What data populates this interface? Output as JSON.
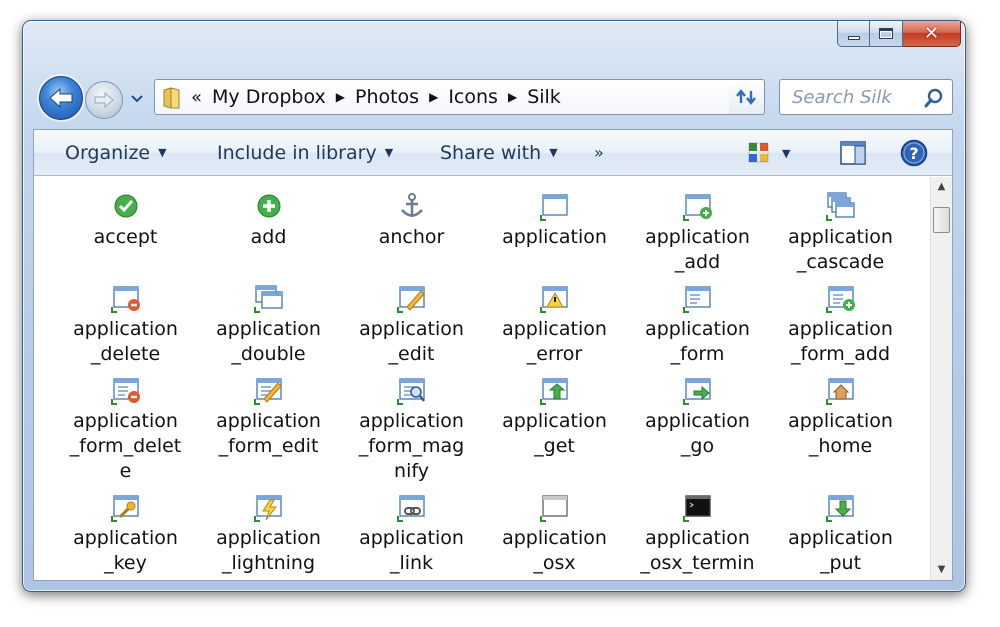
{
  "window": {
    "caption_close": "✕"
  },
  "nav": {
    "back_label": "Back",
    "forward_label": "Forward"
  },
  "address": {
    "chevrons": "«",
    "crumbs": [
      "My Dropbox",
      "Photos",
      "Icons",
      "Silk"
    ]
  },
  "search": {
    "placeholder": "Search Silk"
  },
  "command_bar": {
    "organize": "Organize",
    "include_in_library": "Include in library",
    "share_with": "Share with",
    "more": "»"
  },
  "files": [
    {
      "label": "accept",
      "icon": "accept-icon"
    },
    {
      "label": "add",
      "icon": "add-icon"
    },
    {
      "label": "anchor",
      "icon": "anchor-icon"
    },
    {
      "label": "application",
      "icon": "application-icon"
    },
    {
      "label": "application\n_add",
      "icon": "application-add-icon"
    },
    {
      "label": "application\n_cascade",
      "icon": "application-cascade-icon"
    },
    {
      "label": "application\n_delete",
      "icon": "application-delete-icon"
    },
    {
      "label": "application\n_double",
      "icon": "application-double-icon"
    },
    {
      "label": "application\n_edit",
      "icon": "application-edit-icon"
    },
    {
      "label": "application\n_error",
      "icon": "application-error-icon"
    },
    {
      "label": "application\n_form",
      "icon": "application-form-icon"
    },
    {
      "label": "application\n_form_add",
      "icon": "application-form-add-icon"
    },
    {
      "label": "application\n_form_delet\ne",
      "icon": "application-form-delete-icon"
    },
    {
      "label": "application\n_form_edit",
      "icon": "application-form-edit-icon"
    },
    {
      "label": "application\n_form_mag\nnify",
      "icon": "application-form-magnify-icon"
    },
    {
      "label": "application\n_get",
      "icon": "application-get-icon"
    },
    {
      "label": "application\n_go",
      "icon": "application-go-icon"
    },
    {
      "label": "application\n_home",
      "icon": "application-home-icon"
    },
    {
      "label": "application\n_key",
      "icon": "application-key-icon"
    },
    {
      "label": "application\n_lightning",
      "icon": "application-lightning-icon"
    },
    {
      "label": "application\n_link",
      "icon": "application-link-icon"
    },
    {
      "label": "application\n_osx",
      "icon": "application-osx-icon"
    },
    {
      "label": "application\n_osx_termin",
      "icon": "application-osx-terminal-icon"
    },
    {
      "label": "application\n_put",
      "icon": "application-put-icon"
    }
  ],
  "colors": {
    "command_text": "#1e395b",
    "window_frame": "#b6cbe6",
    "close_red": "#c43b1f"
  }
}
